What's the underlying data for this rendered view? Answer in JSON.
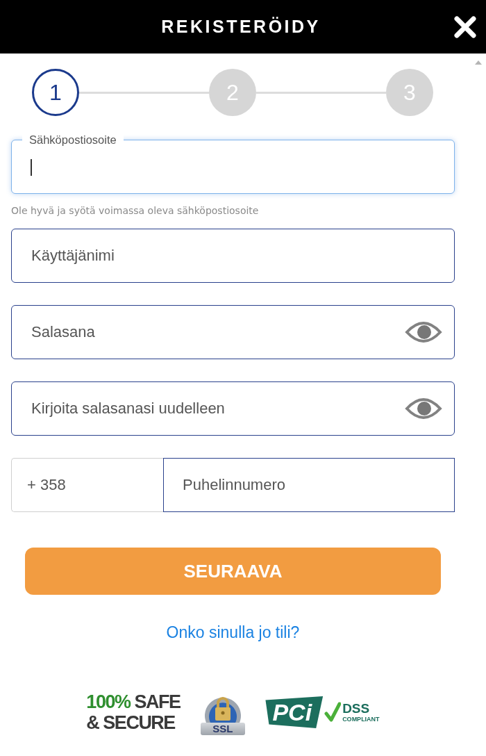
{
  "header": {
    "title": "REKISTERÖIDY"
  },
  "steps": [
    {
      "label": "1",
      "selected": true
    },
    {
      "label": "2",
      "selected": false
    },
    {
      "label": "3",
      "selected": false
    }
  ],
  "fields": [
    {
      "kind": "floating",
      "label": "Sähköpostiosoite",
      "focused": true,
      "hint": "Ole hyvä ja syötä voimassa oleva sähköpostiosoite"
    },
    {
      "kind": "text",
      "placeholder": "Käyttäjänimi",
      "focused": false
    },
    {
      "kind": "password",
      "placeholder": "Salasana",
      "focused": false
    },
    {
      "kind": "password",
      "placeholder": "Kirjoita salasanasi uudelleen",
      "focused": false
    }
  ],
  "phone": {
    "code": "+ 358",
    "placeholder": "Puhelinnumero"
  },
  "submit_button": "SEURAAVA",
  "login_link": "Onko sinulla jo tili?",
  "badges": [
    {
      "kind": "safe",
      "highlight": "100%",
      "text": "SAFE",
      "line2": "& SECURE"
    },
    {
      "kind": "ssl",
      "label": "SSL"
    },
    {
      "kind": "pci",
      "logo": "PCi",
      "title": "DSS",
      "subtitle": "COMPLIANT"
    }
  ]
}
